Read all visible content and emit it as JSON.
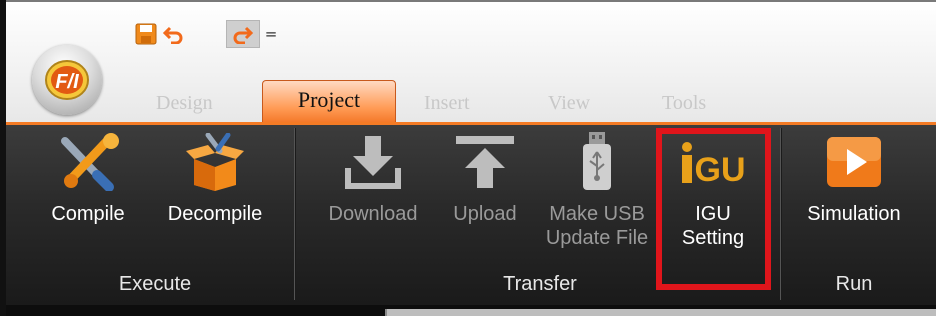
{
  "quick_access": {
    "save_icon": "save-icon",
    "undo_icon": "undo-icon",
    "redo_icon": "redo-icon",
    "customize_glyph": "="
  },
  "app_logo": {
    "icon": "fatek-logo-icon",
    "text": "F/I"
  },
  "tabs": [
    {
      "label": "Design"
    },
    {
      "label": "Project",
      "active": true
    },
    {
      "label": "Insert"
    },
    {
      "label": "View"
    },
    {
      "label": "Tools"
    }
  ],
  "ribbon": {
    "groups": [
      {
        "label": "Execute"
      },
      {
        "label": "Transfer"
      },
      {
        "label": "Run"
      }
    ],
    "buttons": {
      "compile": {
        "label": "Compile",
        "icon": "compile-wrench-screwdriver-icon",
        "enabled": true
      },
      "decompile": {
        "label": "Decompile",
        "icon": "decompile-box-icon",
        "enabled": true
      },
      "download": {
        "label": "Download",
        "icon": "download-arrow-icon",
        "enabled": false
      },
      "upload": {
        "label": "Upload",
        "icon": "upload-arrow-icon",
        "enabled": false
      },
      "make_usb": {
        "label_line1": "Make USB",
        "label_line2": "Update File",
        "icon": "usb-drive-icon",
        "enabled": false
      },
      "igu_setting": {
        "label_line1": "IGU",
        "label_line2": "Setting",
        "icon_text": "iGU",
        "icon": "igu-icon",
        "enabled": true,
        "highlighted": true
      },
      "simulation": {
        "label": "Simulation",
        "icon": "play-icon",
        "enabled": true
      }
    }
  },
  "colors": {
    "accent_orange": "#f47b25",
    "ribbon_dark": "#2a2a2a",
    "highlight_red": "#e0151b",
    "igu_gold": "#e8a11a"
  }
}
